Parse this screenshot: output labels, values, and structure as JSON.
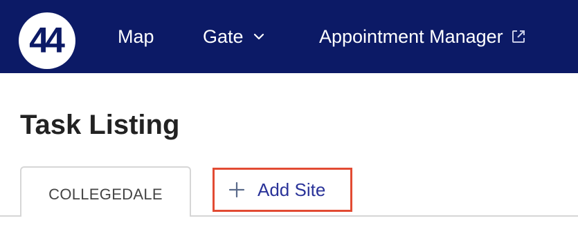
{
  "header": {
    "logo_text": "44",
    "nav": {
      "map": "Map",
      "gate": "Gate",
      "appointment_manager": "Appointment Manager"
    }
  },
  "page": {
    "title": "Task Listing"
  },
  "tabs": {
    "active_label": "COLLEGEDALE",
    "add_site_label": "Add Site"
  },
  "colors": {
    "header_bg": "#0c1a66",
    "accent_text": "#2a3399",
    "highlight_border": "#e24b33"
  },
  "icons": [
    "chevron-down-icon",
    "external-link-icon",
    "plus-icon"
  ]
}
